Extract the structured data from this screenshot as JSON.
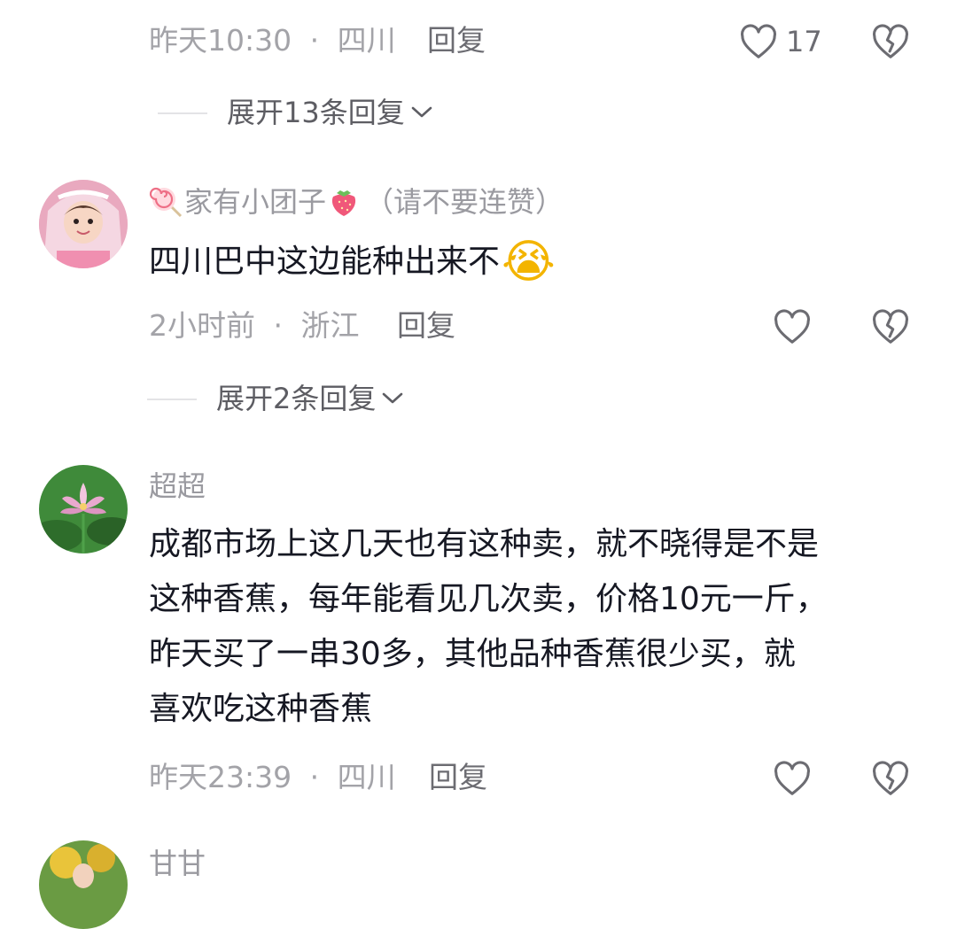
{
  "comment0": {
    "time": "昨天10:30",
    "sep": "·",
    "location": "四川",
    "reply_label": "回复",
    "like_count": "17",
    "expand_label": "展开13条回复"
  },
  "comment1": {
    "username": "家有小团子",
    "username_suffix": "（请不要连赞）",
    "text": "四川巴中这边能种出来不",
    "emoji": "😭",
    "time": "2小时前",
    "sep": "·",
    "location": "浙江",
    "reply_label": "回复",
    "expand_label": "展开2条回复"
  },
  "comment2": {
    "username": "超超",
    "lines": [
      "成都市场上这几天也有这种卖，就不晓得是不是",
      "这种香蕉，每年能看见几次卖，价格10元一斤，",
      "昨天买了一串30多，其他品种香蕉很少买，就",
      "喜欢吃这种香蕉"
    ],
    "time": "昨天23:39",
    "sep": "·",
    "location": "四川",
    "reply_label": "回复"
  },
  "comment3": {
    "username": "甘甘"
  },
  "colors": {
    "meta": "#a3a3a8",
    "content": "#161823",
    "icon": "#6c6c72"
  },
  "icons": [
    "heart-icon",
    "dislike-icon",
    "chevron-down-icon",
    "lollipop-icon",
    "strawberry-icon"
  ]
}
